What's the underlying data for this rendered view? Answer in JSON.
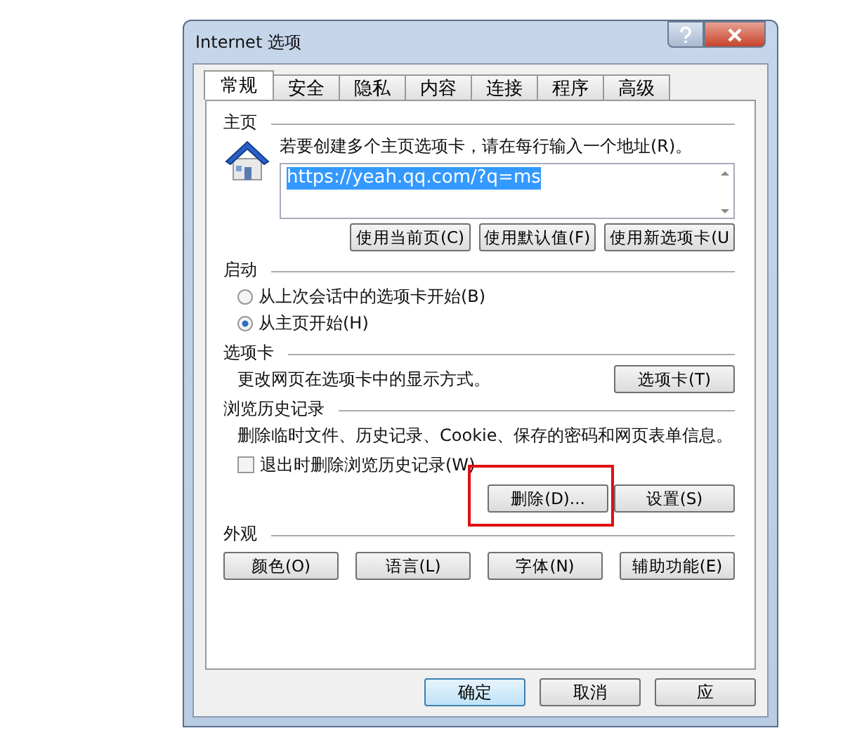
{
  "window": {
    "title": "Internet 选项"
  },
  "tabs": [
    {
      "label": "常规",
      "selected": true
    },
    {
      "label": "安全",
      "selected": false
    },
    {
      "label": "隐私",
      "selected": false
    },
    {
      "label": "内容",
      "selected": false
    },
    {
      "label": "连接",
      "selected": false
    },
    {
      "label": "程序",
      "selected": false
    },
    {
      "label": "高级",
      "selected": false
    }
  ],
  "home": {
    "heading": "主页",
    "hint": "若要创建多个主页选项卡，请在每行输入一个地址(R)。",
    "value": "https://yeah.qq.com/?q=ms",
    "buttons": [
      "使用当前页(C)",
      "使用默认值(F)",
      "使用新选项卡(U"
    ]
  },
  "startup": {
    "heading": "启动",
    "options": [
      {
        "label": "从上次会话中的选项卡开始(B)",
        "selected": false
      },
      {
        "label": "从主页开始(H)",
        "selected": true
      }
    ]
  },
  "tabs_section": {
    "heading": "选项卡",
    "text": "更改网页在选项卡中的显示方式。",
    "button": "选项卡(T)"
  },
  "history": {
    "heading": "浏览历史记录",
    "text": "删除临时文件、历史记录、Cookie、保存的密码和网页表单信息。",
    "checkbox": {
      "label": "退出时删除浏览历史记录(W)",
      "checked": false
    },
    "buttons": [
      {
        "label": "删除(D)...",
        "highlighted": true
      },
      {
        "label": "设置(S)",
        "highlighted": false
      }
    ]
  },
  "appearance": {
    "heading": "外观",
    "buttons": [
      "颜色(O)",
      "语言(L)",
      "字体(N)",
      "辅助功能(E)"
    ]
  },
  "footer": {
    "buttons": [
      {
        "label": "确定",
        "default": true
      },
      {
        "label": "取消",
        "default": false
      },
      {
        "label": "应",
        "default": false
      }
    ]
  }
}
